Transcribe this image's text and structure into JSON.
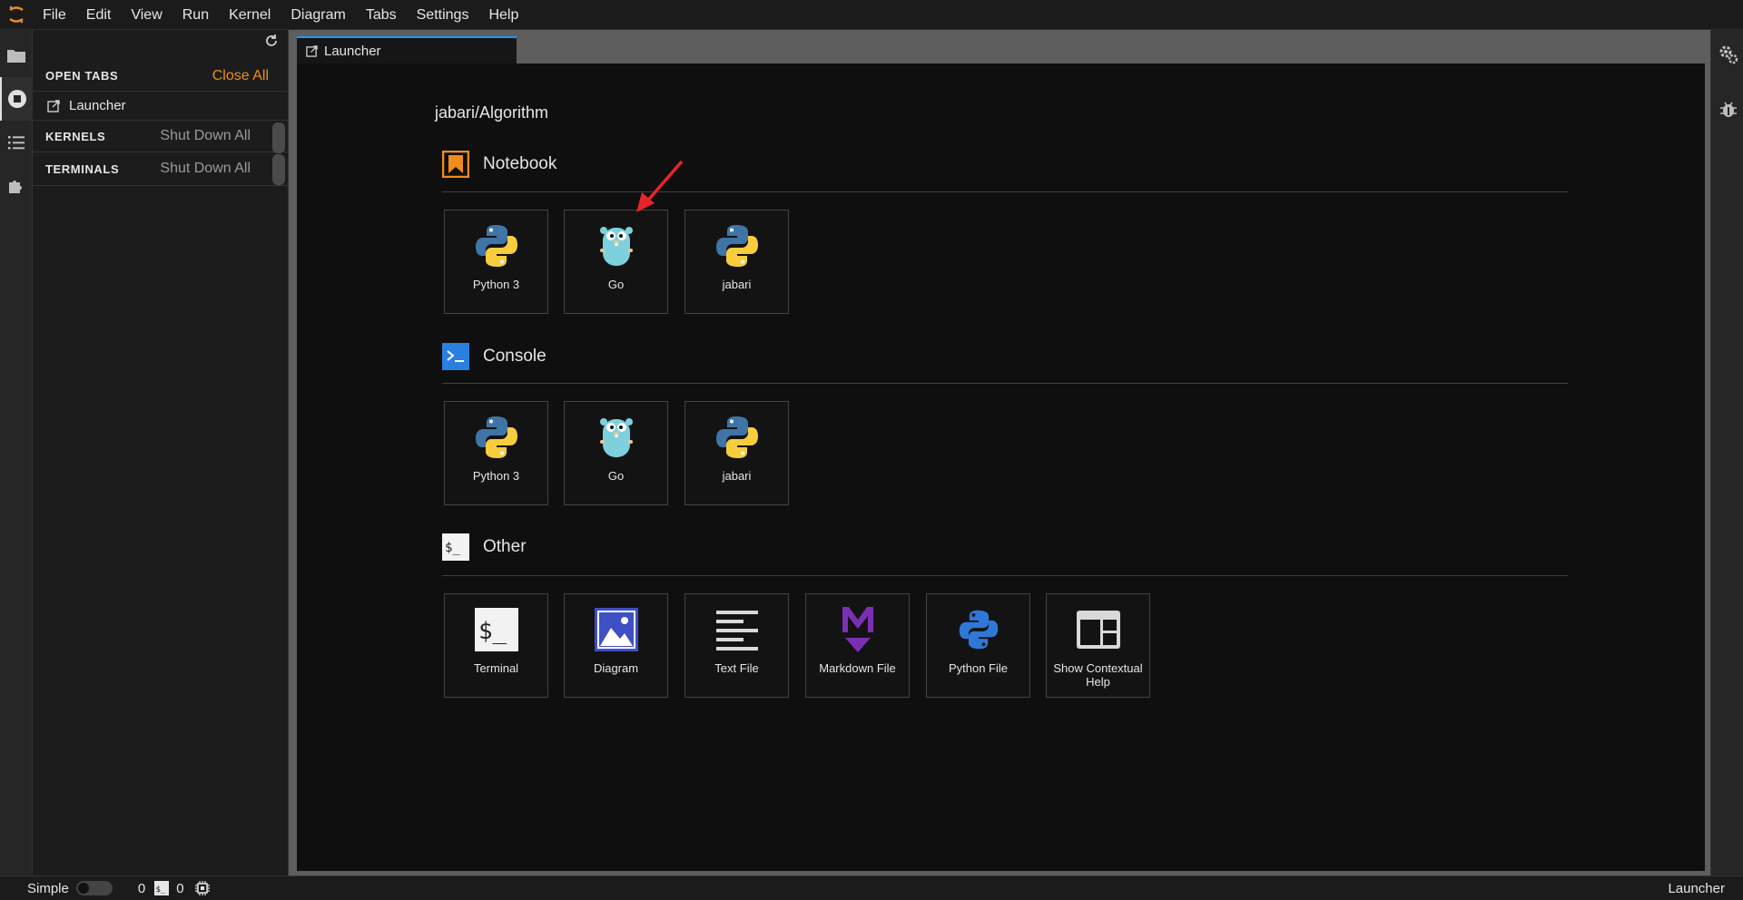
{
  "menubar": {
    "items": [
      "File",
      "Edit",
      "View",
      "Run",
      "Kernel",
      "Diagram",
      "Tabs",
      "Settings",
      "Help"
    ]
  },
  "side_panel": {
    "open_tabs": {
      "title": "OPEN TABS",
      "action": "Close All"
    },
    "launcher_item": "Launcher",
    "kernels": {
      "title": "KERNELS",
      "action": "Shut Down All"
    },
    "terminals": {
      "title": "TERMINALS",
      "action": "Shut Down All"
    }
  },
  "tab": {
    "label": "Launcher"
  },
  "launcher": {
    "cwd": "jabari/Algorithm",
    "notebook": {
      "title": "Notebook",
      "cards": [
        "Python 3",
        "Go",
        "jabari"
      ]
    },
    "console": {
      "title": "Console",
      "cards": [
        "Python 3",
        "Go",
        "jabari"
      ]
    },
    "other": {
      "title": "Other",
      "cards": [
        "Terminal",
        "Diagram",
        "Text File",
        "Markdown File",
        "Python File",
        "Show Contextual Help"
      ]
    }
  },
  "statusbar": {
    "mode_label": "Simple",
    "kernel_count": "0",
    "terminal_count": "0",
    "right_label": "Launcher"
  },
  "colors": {
    "accent_orange": "#f08c1a",
    "tab_blue": "#2196f3",
    "arrow_red": "#e8242b"
  }
}
